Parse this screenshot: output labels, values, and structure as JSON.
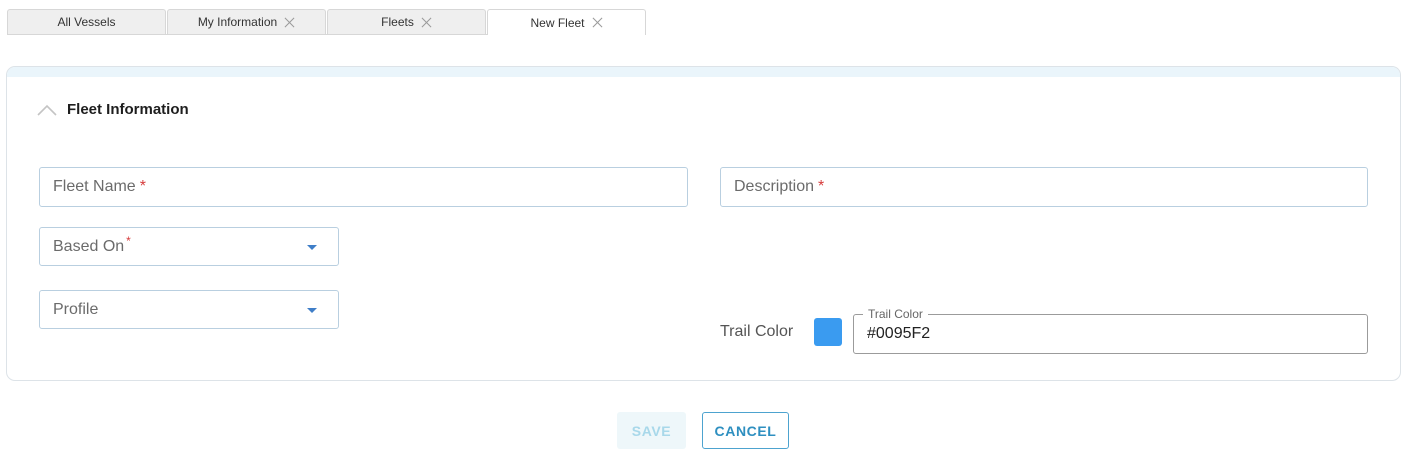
{
  "tabs": [
    {
      "label": "All Vessels",
      "closable": false,
      "active": false
    },
    {
      "label": "My Information",
      "closable": true,
      "active": false
    },
    {
      "label": "Fleets",
      "closable": true,
      "active": false
    },
    {
      "label": "New Fleet",
      "closable": true,
      "active": true
    }
  ],
  "section": {
    "title": "Fleet Information",
    "icon": "chevron-up-icon"
  },
  "form": {
    "fleet_name": {
      "placeholder": "Fleet Name",
      "required_mark": "*",
      "value": ""
    },
    "description": {
      "placeholder": "Description",
      "required_mark": "*",
      "value": ""
    },
    "based_on": {
      "placeholder": "Based On",
      "required_mark": "*",
      "value": ""
    },
    "profile": {
      "placeholder": "Profile",
      "value": ""
    },
    "trail_color": {
      "label": "Trail Color",
      "legend": "Trail Color",
      "value": "#0095F2",
      "swatch_color": "#3a9bf0"
    }
  },
  "actions": {
    "save_label": "SAVE",
    "cancel_label": "CANCEL"
  },
  "colors": {
    "accent": "#2e8fc0",
    "required": "#d63b3b",
    "dropdown_arrow": "#3f7ec8"
  }
}
